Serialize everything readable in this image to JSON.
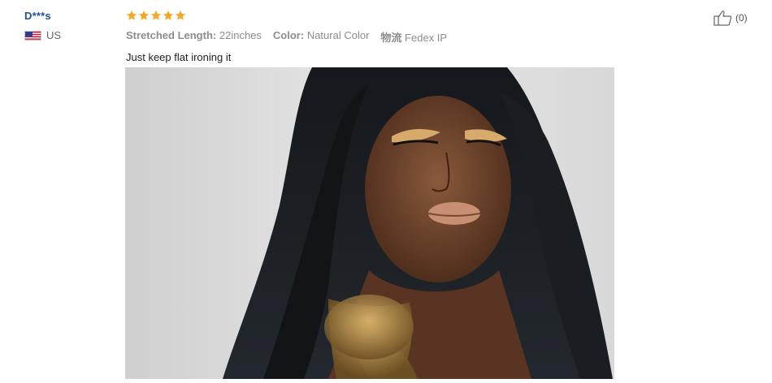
{
  "reviewer": {
    "name": "D***s",
    "country": "US",
    "flag_icon": "us-flag-icon"
  },
  "review": {
    "rating": 5,
    "rating_max": 5,
    "star_color": "#f5a623",
    "attributes": [
      {
        "label": "Stretched Length:",
        "value": "22inches"
      },
      {
        "label": "Color:",
        "value": "Natural Color"
      },
      {
        "label": "物流",
        "value": "Fedex IP"
      }
    ],
    "text": "Just keep flat ironing it"
  },
  "helpful": {
    "icon": "thumbs-up-icon",
    "count_label": "(0)"
  }
}
